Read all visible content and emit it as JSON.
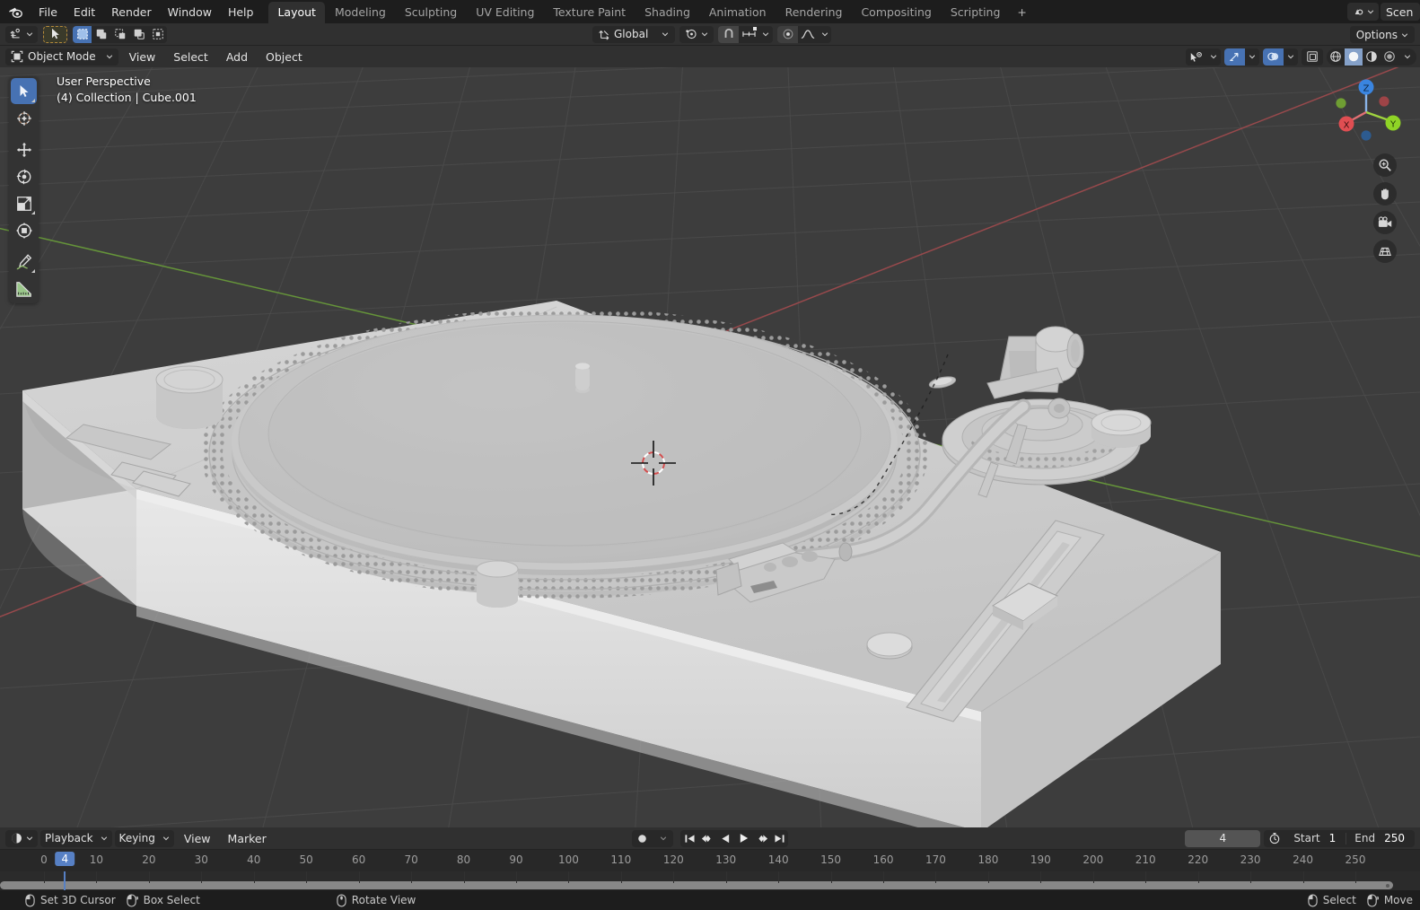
{
  "app": {
    "name": "Blender",
    "logo_icon": "blender-logo-icon"
  },
  "topbar": {
    "menus": [
      "File",
      "Edit",
      "Render",
      "Window",
      "Help"
    ],
    "workspace_tabs": [
      {
        "label": "Layout",
        "active": true
      },
      {
        "label": "Modeling",
        "active": false
      },
      {
        "label": "Sculpting",
        "active": false
      },
      {
        "label": "UV Editing",
        "active": false
      },
      {
        "label": "Texture Paint",
        "active": false
      },
      {
        "label": "Shading",
        "active": false
      },
      {
        "label": "Animation",
        "active": false
      },
      {
        "label": "Rendering",
        "active": false
      },
      {
        "label": "Compositing",
        "active": false
      },
      {
        "label": "Scripting",
        "active": false
      },
      {
        "label": "+",
        "active": false
      }
    ],
    "scene_selector_icon": "scene-icon",
    "scene_name": "Scen"
  },
  "toolheader": {
    "transform_pivot_icon": "transform-pivot-icon",
    "select_mode_icons": [
      "tweak-select-icon",
      "box-select-icon",
      "circle-select-icon",
      "lasso-select-icon",
      "select-all-icon"
    ],
    "active_select_mode": "box-select-icon",
    "cursor_tool_icon": "cursor-tool-icon",
    "orientation_label": "Global",
    "orientation_icon": "orientation-gizmo-icon",
    "pivot_icon": "pivot-point-icon",
    "snap_icon": "snap-magnet-icon",
    "snap_to_icon": "snap-increment-icon",
    "proportional_icon": "proportional-edit-icon",
    "falloff_icon": "proportional-falloff-icon",
    "options_label": "Options"
  },
  "viewport_header": {
    "mode_icon": "object-mode-icon",
    "mode_label": "Object Mode",
    "menus": [
      "View",
      "Select",
      "Add",
      "Object"
    ],
    "right_icons": [
      "visibility-selectability-icon",
      "show-gizmo-icon",
      "show-overlays-icon",
      "toggle-xray-icon",
      "shading-wireframe-icon",
      "shading-solid-icon",
      "shading-material-icon",
      "shading-rendered-icon",
      "shading-options-chevron-icon"
    ],
    "active_shading": "shading-solid-icon"
  },
  "viewport": {
    "overlay_line1": "User Perspective",
    "overlay_line2": "(4) Collection | Cube.001",
    "tools": [
      {
        "name": "tweak-tool",
        "icon": "cursor-arrow-icon",
        "active": true
      },
      {
        "name": "cursor-tool",
        "icon": "3d-cursor-icon",
        "active": false
      },
      {
        "name": "move-tool",
        "icon": "move-arrows-icon",
        "active": false
      },
      {
        "name": "rotate-tool",
        "icon": "rotate-arrows-icon",
        "active": false
      },
      {
        "name": "scale-tool",
        "icon": "scale-corner-icon",
        "active": false
      },
      {
        "name": "transform-tool",
        "icon": "transform-all-icon",
        "active": false
      },
      {
        "name": "annotate-tool",
        "icon": "pencil-icon",
        "active": false
      },
      {
        "name": "measure-tool",
        "icon": "ruler-icon",
        "active": false
      }
    ],
    "gizmo_axes": [
      {
        "label": "X",
        "color": "#e04e52"
      },
      {
        "label": "Y",
        "color": "#8fd426"
      },
      {
        "label": "Z",
        "color": "#3a85e0"
      }
    ],
    "nav_buttons": [
      "zoom-icon",
      "pan-hand-icon",
      "camera-view-icon",
      "toggle-ortho-perspective-icon"
    ],
    "colors": {
      "background": "#3d3d3d",
      "grid": "#4a4a4a",
      "axis_x": "#9c4c4f",
      "axis_y": "#6a9c3a",
      "object": "#b9b9b9"
    },
    "scene_object": "turntable-record-player"
  },
  "timeline": {
    "editor_type_icon": "timeline-editor-icon",
    "menus": [
      "Playback",
      "Keying",
      "View",
      "Marker"
    ],
    "record_icon": "auto-keying-record-icon",
    "transport_icons": [
      "jump-to-start-icon",
      "jump-to-prev-keyframe-icon",
      "play-reverse-icon",
      "play-icon",
      "jump-to-next-keyframe-icon",
      "jump-to-end-icon"
    ],
    "current_frame": "4",
    "use_preview_range_icon": "stopwatch-icon",
    "start_label": "Start",
    "start_value": "1",
    "end_label": "End",
    "end_value": "250",
    "ruler_ticks": [
      0,
      10,
      20,
      30,
      40,
      50,
      60,
      70,
      80,
      90,
      100,
      110,
      120,
      130,
      140,
      150,
      160,
      170,
      180,
      190,
      200,
      210,
      220,
      230,
      240,
      250
    ],
    "playhead_frame": 4
  },
  "statusbar": {
    "left_items": [
      {
        "icon": "mouse-left-icon",
        "label": "Set 3D Cursor"
      },
      {
        "icon": "mouse-left-drag-icon",
        "label": "Box Select"
      },
      {
        "icon": "mouse-middle-icon",
        "label": "Rotate View"
      }
    ],
    "right_items": [
      {
        "icon": "mouse-left-icon",
        "label": "Select"
      },
      {
        "icon": "mouse-left-drag-icon",
        "label": "Move"
      }
    ]
  }
}
